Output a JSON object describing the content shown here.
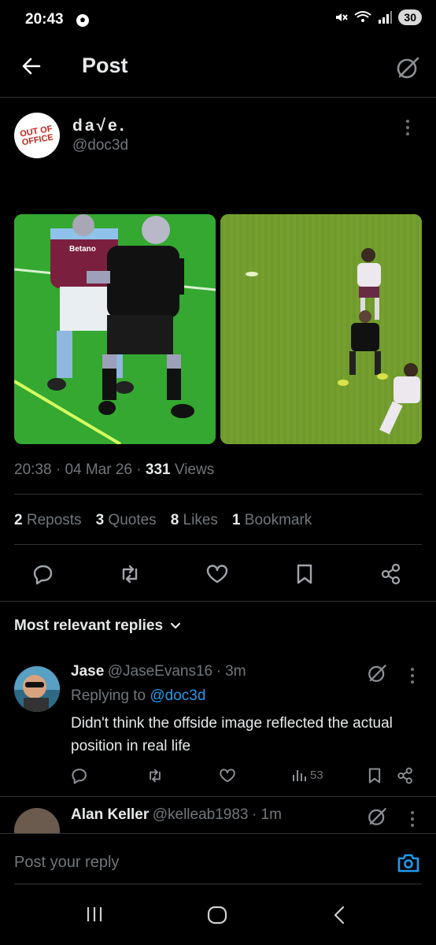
{
  "status_bar": {
    "time": "20:43",
    "battery": "30"
  },
  "header": {
    "title": "Post"
  },
  "post": {
    "author_name": "da√e.",
    "author_handle": "@doc3d",
    "avatar_lines": [
      "OUT OF",
      "OFFICE"
    ],
    "shirt_text_left": "Betano",
    "time": "20:38",
    "date": "04 Mar 26",
    "views_count": "331",
    "views_label": "Views",
    "stats": [
      {
        "count": "2",
        "label": "Reposts"
      },
      {
        "count": "3",
        "label": "Quotes"
      },
      {
        "count": "8",
        "label": "Likes"
      },
      {
        "count": "1",
        "label": "Bookmark"
      }
    ]
  },
  "replies": {
    "heading": "Most relevant replies",
    "items": [
      {
        "name": "Jase",
        "handle": "@JaseEvans16",
        "age": "3m",
        "replying_prefix": "Replying to",
        "replying_to": "@doc3d",
        "text": "Didn't think the offside image reflected the actual position in real life",
        "views": "53"
      },
      {
        "name": "Alan Keller",
        "handle": "@kelleab1983",
        "age": "1m"
      }
    ]
  },
  "compose": {
    "placeholder": "Post your reply"
  },
  "colors": {
    "accent": "#1d9bf0",
    "muted": "#71767b",
    "text": "#e7e9ea"
  }
}
